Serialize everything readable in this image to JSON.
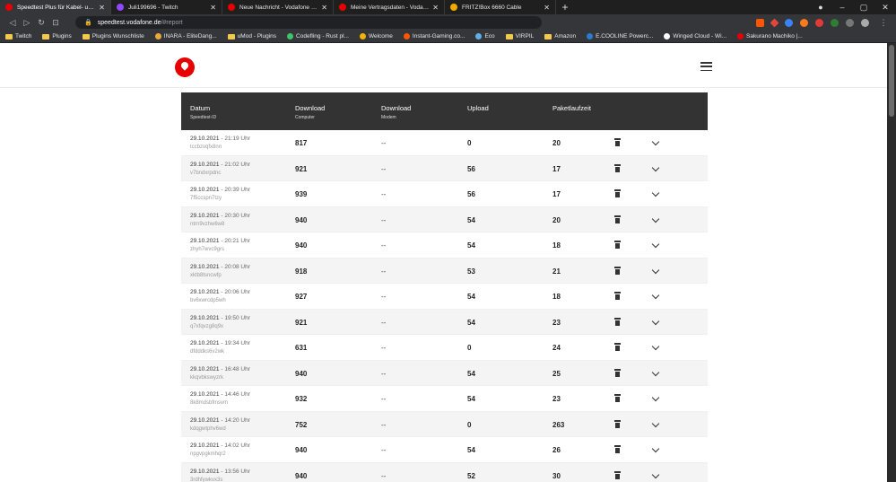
{
  "browser": {
    "tabs": [
      {
        "title": "Speedtest Plus für Kabel- und DSL",
        "color": "#e60000",
        "active": true
      },
      {
        "title": "Juli199696 - Twitch",
        "color": "#9146ff",
        "active": false
      },
      {
        "title": "Neue Nachricht - Vodafone Communit",
        "color": "#e60000",
        "active": false
      },
      {
        "title": "Meine Vertragsdaten - Vodafone Kund",
        "color": "#e60000",
        "active": false
      },
      {
        "title": "FRITZ!Box 6660 Cable",
        "color": "#f2a900",
        "active": false
      }
    ],
    "url_host": "speedtest.vodafone.de",
    "url_path": "/#report",
    "bookmarks": [
      {
        "label": "Twitch",
        "type": "folder"
      },
      {
        "label": "Plugins",
        "type": "folder"
      },
      {
        "label": "Plugins Wunschliste",
        "type": "folder"
      },
      {
        "label": "INARA - EliteDang...",
        "type": "site",
        "color": "#e8a93a"
      },
      {
        "label": "uMod - Plugins",
        "type": "folder"
      },
      {
        "label": "Codefling - Rust pl...",
        "type": "site",
        "color": "#3ec46d"
      },
      {
        "label": "Welcome",
        "type": "site",
        "color": "#f5b400"
      },
      {
        "label": "Instant-Gaming.co...",
        "type": "site",
        "color": "#ff5400"
      },
      {
        "label": "Eco",
        "type": "site",
        "color": "#5fb0e8"
      },
      {
        "label": "VIRPIL",
        "type": "folder"
      },
      {
        "label": "Amazon",
        "type": "folder"
      },
      {
        "label": "E.COOLINE Powerc...",
        "type": "site",
        "color": "#2b7bd3"
      },
      {
        "label": "Winged Cloud - Wi...",
        "type": "site",
        "color": "#ffffff"
      },
      {
        "label": "Sakurano Machiko |...",
        "type": "site",
        "color": "#e60000"
      }
    ]
  },
  "table": {
    "headers": {
      "datum": "Datum",
      "datum_sub": "Speedtest-ID",
      "download_pc": "Download",
      "download_pc_sub": "Computer",
      "download_modem": "Download",
      "download_modem_sub": "Modem",
      "upload": "Upload",
      "ping": "Paketlaufzeit"
    },
    "rows": [
      {
        "date": "29.10.2021",
        "time": "21:19 Uhr",
        "id": "tccbzvqfx8nn",
        "download": "817",
        "modem": "--",
        "upload": "0",
        "ping": "20"
      },
      {
        "date": "29.10.2021",
        "time": "21:02 Uhr",
        "id": "v7bndxrpdnc",
        "download": "921",
        "modem": "--",
        "upload": "56",
        "ping": "17"
      },
      {
        "date": "29.10.2021",
        "time": "20:39 Uhr",
        "id": "7f5ccspn7tzy",
        "download": "939",
        "modem": "--",
        "upload": "56",
        "ping": "17"
      },
      {
        "date": "29.10.2021",
        "time": "20:30 Uhr",
        "id": "ntrn9vzhw6w8",
        "download": "940",
        "modem": "--",
        "upload": "54",
        "ping": "20"
      },
      {
        "date": "29.10.2021",
        "time": "20:21 Uhr",
        "id": "zhyh7wvc9grs",
        "download": "940",
        "modem": "--",
        "upload": "54",
        "ping": "18"
      },
      {
        "date": "29.10.2021",
        "time": "20:08 Uhr",
        "id": "xktb8tsncwfp",
        "download": "918",
        "modem": "--",
        "upload": "53",
        "ping": "21"
      },
      {
        "date": "29.10.2021",
        "time": "20:06 Uhr",
        "id": "bv6xwrcdp5wh",
        "download": "927",
        "modem": "--",
        "upload": "54",
        "ping": "18"
      },
      {
        "date": "29.10.2021",
        "time": "19:50 Uhr",
        "id": "q7xfqvzg8q9x",
        "download": "921",
        "modem": "--",
        "upload": "54",
        "ping": "23"
      },
      {
        "date": "29.10.2021",
        "time": "19:34 Uhr",
        "id": "dfdddks6v2wk",
        "download": "631",
        "modem": "--",
        "upload": "0",
        "ping": "24"
      },
      {
        "date": "29.10.2021",
        "time": "16:48 Uhr",
        "id": "kkqvbkswyzrk",
        "download": "940",
        "modem": "--",
        "upload": "54",
        "ping": "25"
      },
      {
        "date": "29.10.2021",
        "time": "14:46 Uhr",
        "id": "8k8mdsbfmsvm",
        "download": "932",
        "modem": "--",
        "upload": "54",
        "ping": "23"
      },
      {
        "date": "29.10.2021",
        "time": "14:20 Uhr",
        "id": "kdqgwtphv6wd",
        "download": "752",
        "modem": "--",
        "upload": "0",
        "ping": "263"
      },
      {
        "date": "29.10.2021",
        "time": "14:02 Uhr",
        "id": "npgvpgkmhqr2",
        "download": "940",
        "modem": "--",
        "upload": "54",
        "ping": "26"
      },
      {
        "date": "29.10.2021",
        "time": "13:56 Uhr",
        "id": "3rdhfywkvx3s",
        "download": "940",
        "modem": "--",
        "upload": "52",
        "ping": "30"
      }
    ]
  }
}
